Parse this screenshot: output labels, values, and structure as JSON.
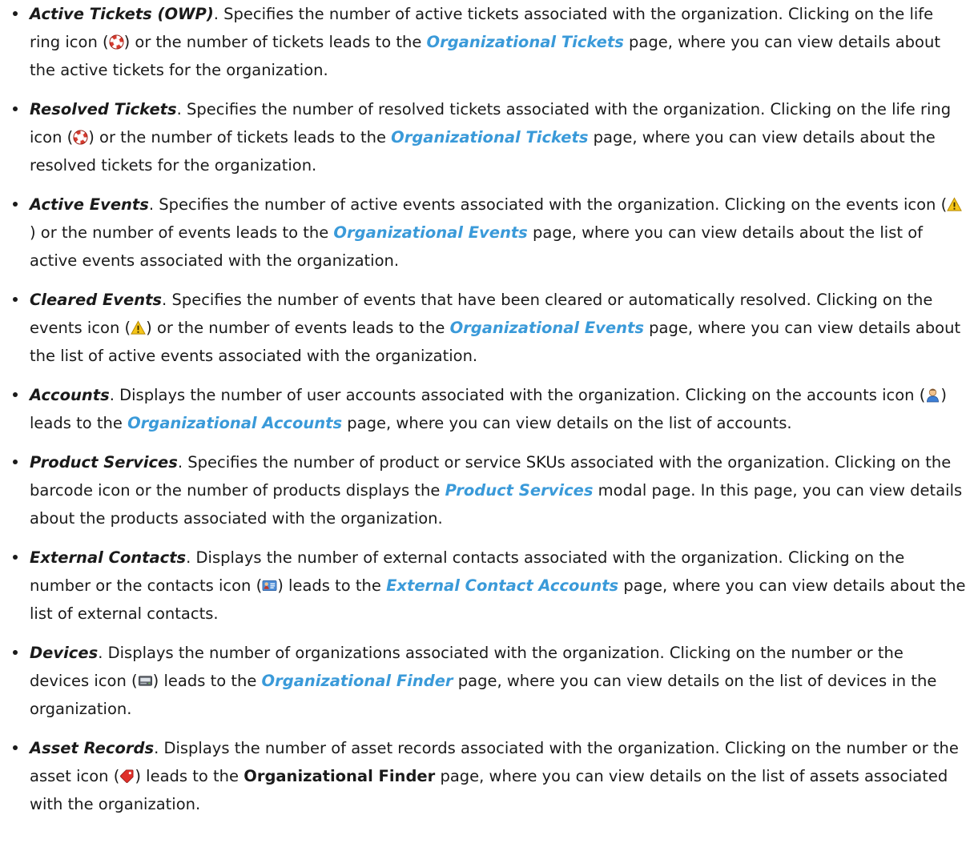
{
  "items": [
    {
      "term": "Active Tickets (OWP)",
      "p1": ". Specifies the number of active tickets associated with the organization. Clicking on the life ring icon (",
      "icon": "life-ring-icon",
      "p2": ") or the number of tickets leads to the ",
      "link": "Organizational Tickets",
      "p3": " page, where you can view details about the active tickets for the organization."
    },
    {
      "term": "Resolved Tickets",
      "p1": ". Specifies the number of resolved tickets associated with the organization. Clicking on the life ring icon (",
      "icon": "life-ring-icon",
      "p2": ") or the number of tickets leads to the ",
      "link": "Organizational Tickets",
      "p3": " page, where you can view details about the resolved tickets for the organization."
    },
    {
      "term": "Active Events",
      "p1": ". Specifies the number of active events associated with the organization. Clicking on the events icon (",
      "icon": "warning-icon",
      "p2": ") or the number of events leads to the ",
      "link": "Organizational Events",
      "p3": " page, where you can view details about the list of active events associated with the organization."
    },
    {
      "term": "Cleared Events",
      "p1": ". Specifies the number of events that have been cleared or automatically resolved. Clicking on the events icon (",
      "icon": "warning-icon",
      "p2": ") or the number of events leads to the ",
      "link": "Organizational Events",
      "p3": " page, where you can view details about the list of active events associated with the organization."
    },
    {
      "term": "Accounts",
      "p1": ". Displays the number of user accounts associated with the organization. Clicking on the accounts icon (",
      "icon": "user-icon",
      "p2": ") leads to the ",
      "link": "Organizational Accounts",
      "p3": " page, where you can view details on the list of accounts."
    },
    {
      "term": "Product Services",
      "p1": ". Specifies the number of product or service SKUs associated with the organization. Clicking on the barcode icon or the number of products displays the ",
      "link": "Product Services",
      "p3": " modal page. In this page, you can view details about the products associated with the organization."
    },
    {
      "term": "External Contacts",
      "p1": ". Displays the number of external contacts associated with the organization. Clicking on the number or the contacts icon (",
      "icon": "contact-card-icon",
      "p2": ") leads to the ",
      "link": "External Contact Accounts",
      "p3": " page, where you can view details about the list of external contacts."
    },
    {
      "term": "Devices",
      "p1": ". Displays the number of organizations associated with the organization. Clicking on the number or the devices icon (",
      "icon": "device-icon",
      "p2": ") leads to the ",
      "link": "Organizational Finder",
      "p3": " page, where you can view details on the list of devices in the organization."
    },
    {
      "term": "Asset Records",
      "p1": ". Displays the number of asset records associated with the organization. Clicking on the number or the asset icon (",
      "icon": "asset-tag-icon",
      "p2": ") leads to the ",
      "bold_ref": "Organizational Finder",
      "p3": " page, where you can view details on the list of assets associated with the organization."
    }
  ]
}
